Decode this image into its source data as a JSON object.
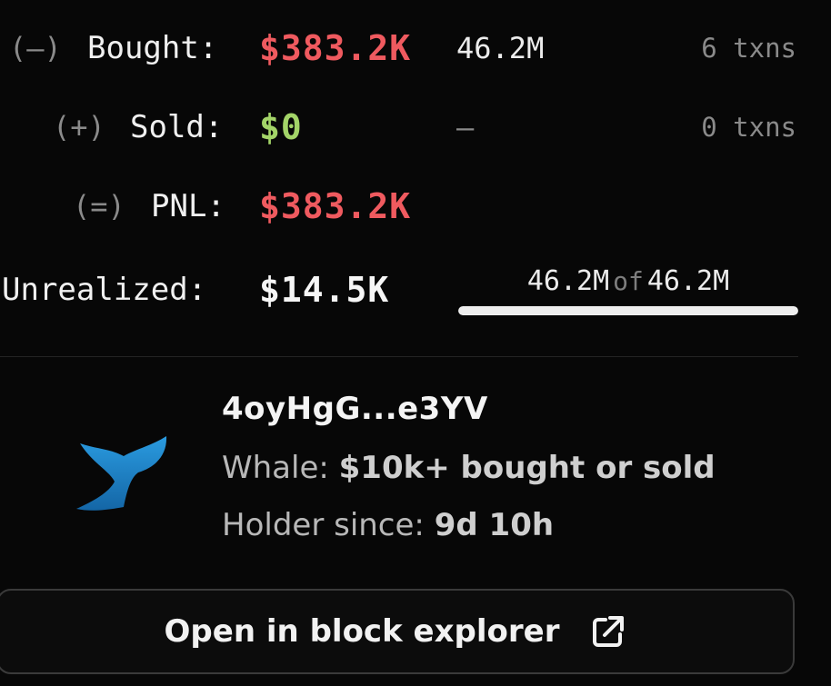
{
  "colors": {
    "negative": "#ef5a5f",
    "positive": "#a3d468",
    "whale_blue": "#1e86c9"
  },
  "pnl": {
    "bought": {
      "op": "(–)",
      "label": "Bought:",
      "amount": "$383.2K",
      "qty": "46.2M",
      "txns": "6 txns"
    },
    "sold": {
      "op": "(+)",
      "label": "Sold:",
      "amount": "$0",
      "qty": "–",
      "txns": "0 txns"
    },
    "pnl": {
      "op": "(=)",
      "label": "PNL:",
      "amount": "$383.2K"
    },
    "unrealized": {
      "label": "Unrealized:",
      "amount": "$14.5K",
      "held": "46.2M",
      "of": "of",
      "total": "46.2M",
      "held_fraction": 1.0
    }
  },
  "holder": {
    "icon": "whale-icon",
    "wallet": "4oyHgG...e3YV",
    "whale_label": "Whale:",
    "whale_value": "$10k+ bought or sold",
    "since_label": "Holder since:",
    "since_value": "9d 10h"
  },
  "explorer_button": {
    "label": "Open in block explorer",
    "icon": "external-link-icon"
  }
}
